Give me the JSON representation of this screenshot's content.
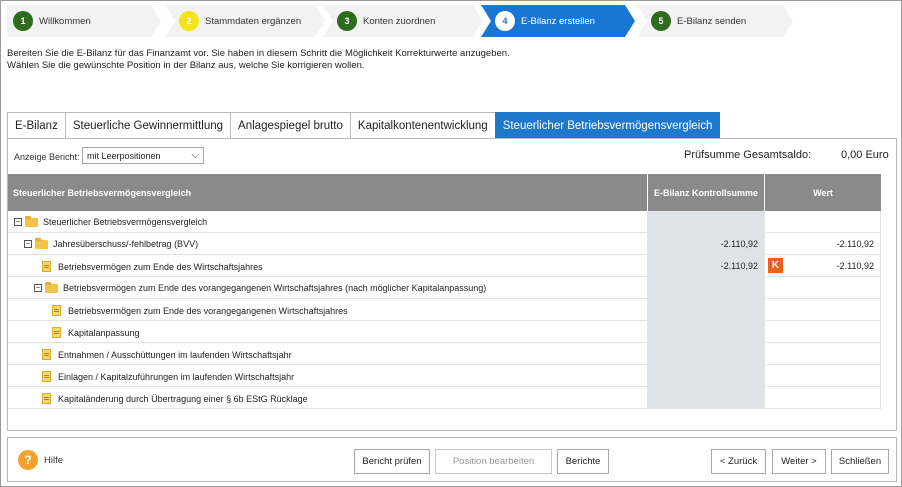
{
  "wizard": {
    "steps": [
      {
        "num": "1",
        "label": "Willkommen"
      },
      {
        "num": "2",
        "label": "Stammdaten ergänzen"
      },
      {
        "num": "3",
        "label": "Konten zuordnen"
      },
      {
        "num": "4",
        "label": "E-Bilanz erstellen"
      },
      {
        "num": "5",
        "label": "E-Bilanz senden"
      }
    ]
  },
  "intro": {
    "line1": "Bereiten Sie die E-Bilanz für das Finanzamt vor. Sie haben in diesem Schritt die Möglichkeit Korrekturwerte anzugeben.",
    "line2": "Wählen Sie die gewünschte Position in der Bilanz aus, welche Sie korrigieren wollen."
  },
  "tabs": [
    {
      "label": "E-Bilanz"
    },
    {
      "label": "Steuerliche Gewinnermittlung"
    },
    {
      "label": "Anlagespiegel brutto"
    },
    {
      "label": "Kapitalkontenentwicklung"
    },
    {
      "label": "Steuerlicher Betriebsvermögensvergleich"
    }
  ],
  "report": {
    "label": "Anzeige Bericht:",
    "selected": "mit Leerpositionen"
  },
  "checksum": {
    "label": "Prüfsumme Gesamtsaldo:",
    "value": "0,00  Euro"
  },
  "grid": {
    "headers": {
      "position": "Steuerlicher Betriebsvermögensvergleich",
      "control": "E-Bilanz Kontrollsumme",
      "value": "Wert"
    },
    "rows": [
      {
        "label": "Steuerlicher Betriebsvermögensvergleich",
        "control": "",
        "value": "",
        "badge": ""
      },
      {
        "label": "Jahresüberschuss/-fehlbetrag (BVV)",
        "control": "-2.110,92",
        "value": "-2.110,92",
        "badge": ""
      },
      {
        "label": "Betriebsvermögen zum Ende des Wirtschaftsjahres",
        "control": "-2.110,92",
        "value": "-2.110,92",
        "badge": "K"
      },
      {
        "label": "Betriebsvermögen zum Ende des vorangegangenen Wirtschaftsjahres (nach möglicher Kapitalanpassung)",
        "control": "",
        "value": "",
        "badge": ""
      },
      {
        "label": "Betriebsvermögen zum Ende des vorangegangenen Wirtschaftsjahres",
        "control": "",
        "value": "",
        "badge": ""
      },
      {
        "label": "Kapitalanpassung",
        "control": "",
        "value": "",
        "badge": ""
      },
      {
        "label": "Entnahmen / Ausschüttungen im laufenden Wirtschaftsjahr",
        "control": "",
        "value": "",
        "badge": ""
      },
      {
        "label": "Einlagen / Kapitalzuführungen im laufenden Wirtschaftsjahr",
        "control": "",
        "value": "",
        "badge": ""
      },
      {
        "label": "Kapitaländerung durch Übertragung einer § 6b EStG Rücklage",
        "control": "",
        "value": "",
        "badge": ""
      }
    ]
  },
  "footer": {
    "help": "Hilfe",
    "check_report": "Bericht prüfen",
    "edit_position": "Position bearbeiten",
    "reports": "Berichte",
    "back": "< Zurück",
    "next": "Weiter >",
    "close": "Schließen"
  }
}
